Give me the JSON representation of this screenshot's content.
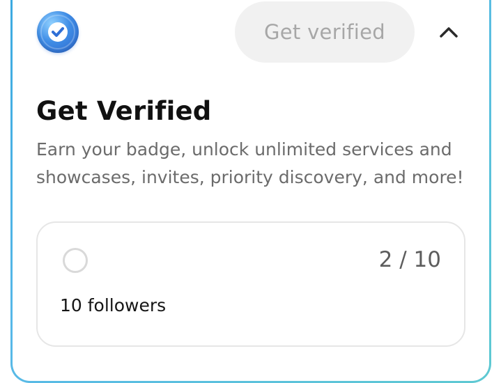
{
  "header": {
    "badge_icon": "verified-check-badge-icon",
    "get_verified_button": "Get verified",
    "collapse_icon": "chevron-up-icon"
  },
  "section": {
    "title": "Get Verified",
    "description": "Earn your badge, unlock unlimited services and showcases, invites, priority discovery, and more!"
  },
  "tasks": [
    {
      "label": "10 followers",
      "progress": "2 / 10",
      "completed": false
    }
  ],
  "colors": {
    "card_border_start": "#3aa9e0",
    "card_border_end": "#5ec9d2",
    "badge_blue": "#3f8de6",
    "button_bg": "#f1f1f1",
    "button_text": "#a7a7a7"
  }
}
